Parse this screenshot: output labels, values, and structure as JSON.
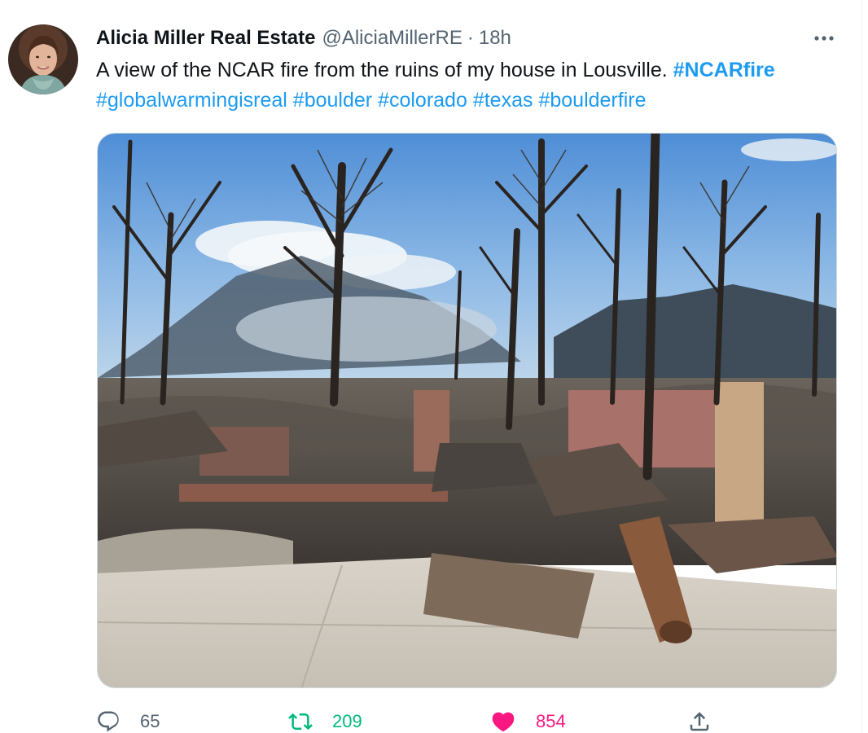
{
  "author": {
    "name": "Alicia Miller Real Estate",
    "handle": "@AliciaMillerRE",
    "separator": "·",
    "time": "18h"
  },
  "tweet": {
    "text_prefix": "A view of the NCAR fire from the ruins of my house in Lousville. ",
    "hashtags": [
      "#NCARfire",
      "#globalwarmingisreal",
      "#boulder",
      "#colorado",
      "#texas",
      "#boulderfire"
    ]
  },
  "media": {
    "alt": "Burned ruins of a house with bare charred trees and smoke over mountains"
  },
  "actions": {
    "replies": "65",
    "retweets": "209",
    "likes": "854"
  },
  "icons": {
    "more": "more-horizontal-icon",
    "reply": "reply-icon",
    "retweet": "retweet-icon",
    "like": "heart-filled-icon",
    "share": "share-icon"
  },
  "colors": {
    "link": "#1d9bf0",
    "retweet_active": "#00ba7c",
    "like_active": "#f91880",
    "secondary_text": "#536471"
  }
}
